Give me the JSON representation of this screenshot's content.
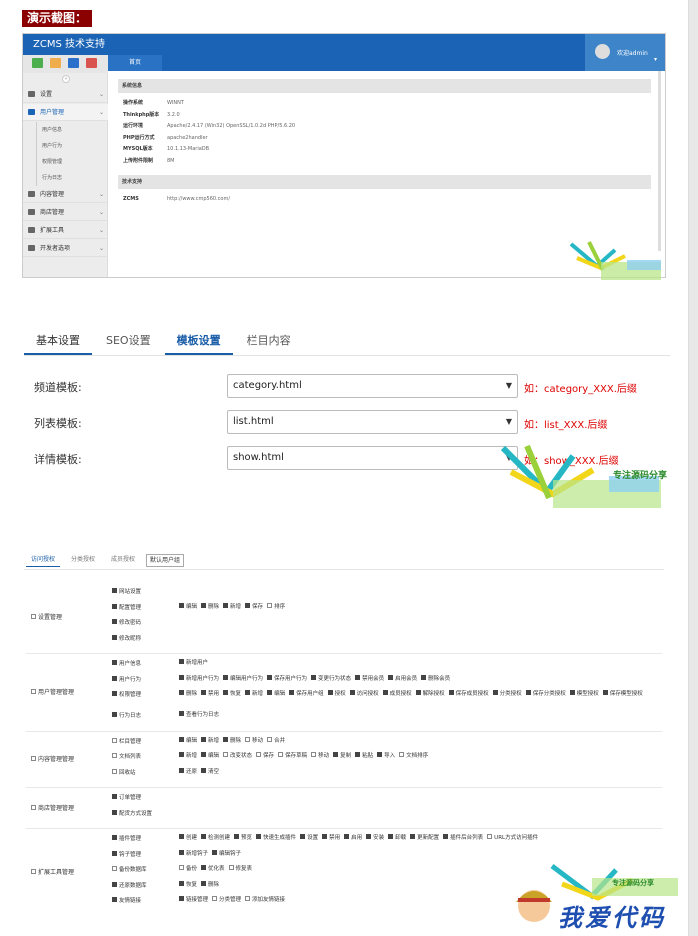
{
  "demo_title": "演示截图：",
  "admin": {
    "app_title": "ZCMS 技术支持",
    "user_name": "欢迎admin",
    "tab_home": "首页",
    "quick_buttons": [
      {
        "name": "home",
        "color": "#4cae4c"
      },
      {
        "name": "user",
        "color": "#f0ad4e"
      },
      {
        "name": "edit",
        "color": "#2a6fc9"
      },
      {
        "name": "delete",
        "color": "#d9534f"
      }
    ],
    "collapse_glyph": "«",
    "sidebar": [
      {
        "label": "设置",
        "icon": "gear-icon"
      },
      {
        "label": "用户管理",
        "icon": "users-icon",
        "open": true,
        "children": [
          "用户信息",
          "用户行为",
          "权限管理",
          "行为日志"
        ]
      },
      {
        "label": "内容管理",
        "icon": "list-icon"
      },
      {
        "label": "商店管理",
        "icon": "cart-icon"
      },
      {
        "label": "扩展工具",
        "icon": "cloud-icon"
      },
      {
        "label": "开发者选项",
        "icon": "apple-icon"
      }
    ],
    "system_info": {
      "heading": "系统信息",
      "rows": [
        {
          "k": "操作系统",
          "v": "WINNT"
        },
        {
          "k": "Thinkphp版本",
          "v": "3.2.0"
        },
        {
          "k": "运行环境",
          "v": "Apache/2.4.17 (Win32) OpenSSL/1.0.2d PHP/5.6.20"
        },
        {
          "k": "PHP运行方式",
          "v": "apache2handler"
        },
        {
          "k": "MYSQL版本",
          "v": "10.1.13-MariaDB"
        },
        {
          "k": "上传附件限制",
          "v": "8M"
        }
      ]
    },
    "tech_support": {
      "heading": "技术支持",
      "rows": [
        {
          "k": "ZCMS",
          "v": "http://www.cmp560.com/"
        }
      ]
    }
  },
  "watermark": {
    "text": "专注源码分享"
  },
  "watermark_big": {
    "text": "我爱代码"
  },
  "settings": {
    "tabs": [
      "基本设置",
      "SEO设置",
      "模板设置",
      "栏目内容"
    ],
    "active_tab": 2,
    "fields": [
      {
        "label": "频道模板:",
        "value": "category.html",
        "hint": "如：category_XXX.后缀"
      },
      {
        "label": "列表模板:",
        "value": "list.html",
        "hint": "如：list_XXX.后缀"
      },
      {
        "label": "详情模板:",
        "value": "show.html",
        "hint": "如：show_XXX.后缀"
      }
    ],
    "select_arrow": "▼"
  },
  "permissions": {
    "tabs": [
      "访问授权",
      "分类授权",
      "成员授权"
    ],
    "group_select": "默认用户组",
    "groups": [
      {
        "label": "设置管理",
        "rows": [
          {
            "name": "网站设置",
            "on": true,
            "perms": []
          },
          {
            "name": "配置管理",
            "on": true,
            "perms": [
              [
                "编辑",
                true
              ],
              [
                "删除",
                true
              ],
              [
                "新增",
                true
              ],
              [
                "保存",
                true
              ],
              [
                "排序",
                false
              ]
            ]
          },
          {
            "name": "修改密码",
            "on": true,
            "perms": []
          },
          {
            "name": "修改昵称",
            "on": true,
            "perms": []
          }
        ]
      },
      {
        "label": "用户管理管理",
        "rows": [
          {
            "name": "用户信息",
            "on": true,
            "perms": [
              [
                "新增用户",
                true
              ]
            ]
          },
          {
            "name": "用户行为",
            "on": true,
            "perms": [
              [
                "新增用户行为",
                true
              ],
              [
                "编辑用户行为",
                true
              ],
              [
                "保存用户行为",
                true
              ],
              [
                "变更行为状态",
                true
              ],
              [
                "禁用会员",
                true
              ],
              [
                "启用会员",
                true
              ],
              [
                "删除会员",
                true
              ]
            ]
          },
          {
            "name": "权限管理",
            "on": true,
            "perms": [
              [
                "删除",
                true
              ],
              [
                "禁用",
                true
              ],
              [
                "恢复",
                true
              ],
              [
                "新增",
                true
              ],
              [
                "编辑",
                true
              ],
              [
                "保存用户组",
                true
              ],
              [
                "授权",
                true
              ],
              [
                "访问授权",
                true
              ],
              [
                "成员授权",
                true
              ],
              [
                "解除授权",
                true
              ],
              [
                "保存成员授权",
                true
              ],
              [
                "分类授权",
                true
              ],
              [
                "保存分类授权",
                true
              ],
              [
                "模型授权",
                true
              ],
              [
                "保存模型授权",
                true
              ]
            ]
          },
          {
            "name": "行为日志",
            "on": true,
            "perms": [
              [
                "查看行为日志",
                true
              ]
            ]
          }
        ]
      },
      {
        "label": "内容管理管理",
        "rows": [
          {
            "name": "栏目管理",
            "on": false,
            "perms": [
              [
                "编辑",
                true
              ],
              [
                "新增",
                true
              ],
              [
                "删除",
                true
              ],
              [
                "移动",
                false
              ],
              [
                "合并",
                false
              ]
            ]
          },
          {
            "name": "文档列表",
            "on": false,
            "perms": [
              [
                "新增",
                true
              ],
              [
                "编辑",
                true
              ],
              [
                "改变状态",
                false
              ],
              [
                "保存",
                false
              ],
              [
                "保存草稿",
                false
              ],
              [
                "移动",
                false
              ],
              [
                "复制",
                true
              ],
              [
                "粘贴",
                true
              ],
              [
                "导入",
                true
              ],
              [
                "文档排序",
                false
              ]
            ]
          },
          {
            "name": "回收站",
            "on": false,
            "perms": [
              [
                "还原",
                true
              ],
              [
                "清空",
                true
              ]
            ]
          }
        ]
      },
      {
        "label": "商店管理管理",
        "rows": [
          {
            "name": "订单管理",
            "on": true,
            "perms": []
          },
          {
            "name": "配货方式设置",
            "on": true,
            "perms": []
          }
        ]
      },
      {
        "label": "扩展工具管理",
        "rows": [
          {
            "name": "插件管理",
            "on": true,
            "perms": [
              [
                "创建",
                true
              ],
              [
                "检测创建",
                true
              ],
              [
                "预览",
                true
              ],
              [
                "快速生成插件",
                true
              ],
              [
                "设置",
                true
              ],
              [
                "禁用",
                true
              ],
              [
                "启用",
                true
              ],
              [
                "安装",
                true
              ],
              [
                "卸载",
                true
              ],
              [
                "更新配置",
                true
              ],
              [
                "插件后台列表",
                true
              ],
              [
                "URL方式访问插件",
                false
              ]
            ]
          },
          {
            "name": "钩子管理",
            "on": true,
            "perms": [
              [
                "新增钩子",
                true
              ],
              [
                "编辑钩子",
                true
              ]
            ]
          },
          {
            "name": "备份数据库",
            "on": false,
            "perms": [
              [
                "备份",
                false
              ],
              [
                "优化表",
                true
              ],
              [
                "修复表",
                false
              ]
            ]
          },
          {
            "name": "还原数据库",
            "on": true,
            "perms": [
              [
                "恢复",
                true
              ],
              [
                "删除",
                true
              ]
            ]
          },
          {
            "name": "友情链接",
            "on": true,
            "perms": [
              [
                "链接管理",
                true
              ],
              [
                "分类管理",
                false
              ],
              [
                "添加友情链接",
                false
              ]
            ]
          }
        ]
      }
    ]
  }
}
